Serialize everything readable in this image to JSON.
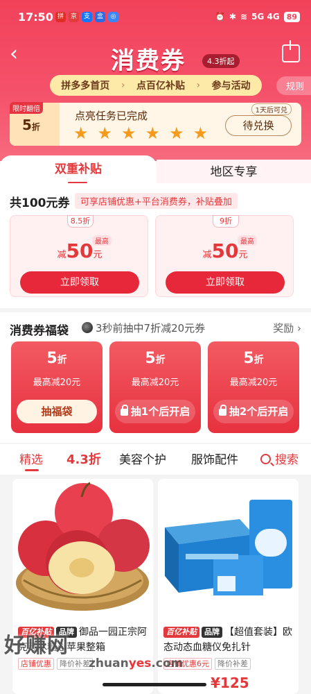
{
  "status": {
    "time": "17:50",
    "battery": "89",
    "network": "5G 4G",
    "apps": [
      "拼",
      "京",
      "支",
      "盒",
      "◎"
    ]
  },
  "header": {
    "title": "消费券",
    "discount_pill": "4.3折起",
    "rules": "规则"
  },
  "breadcrumb": {
    "items": [
      "拼多多首页",
      "点百亿补贴",
      "参与活动"
    ],
    "sep": "›"
  },
  "task": {
    "tag_top": "限时翻倍",
    "tag_value": "5",
    "tag_unit": "折",
    "message": "点亮任务已完成",
    "stars": 6,
    "badge": "1天后可兑",
    "button": "待兑换"
  },
  "tabs": {
    "active": "双重补贴",
    "other": "地区专享"
  },
  "coupons": {
    "title": "共100元券",
    "hint": "可享店铺优惠+平台消费券，补贴叠加",
    "cards": [
      {
        "discount": "8.5折",
        "max": "最高",
        "prefix": "减",
        "amount": "50",
        "unit": "元",
        "button": "立即领取"
      },
      {
        "discount": "9折",
        "max": "最高",
        "prefix": "减",
        "amount": "50",
        "unit": "元",
        "button": "立即领取"
      }
    ]
  },
  "bag": {
    "title": "消费券福袋",
    "live": "3秒前抽中7折减20元券",
    "reward": "奖励 ›",
    "cards": [
      {
        "value": "5",
        "unit": "折",
        "sub": "最高减20元",
        "button": "抽福袋",
        "locked": false
      },
      {
        "value": "5",
        "unit": "折",
        "sub": "最高减20元",
        "button": "抽1个后开启",
        "locked": true
      },
      {
        "value": "5",
        "unit": "折",
        "sub": "最高减20元",
        "button": "抽2个后开启",
        "locked": true
      }
    ]
  },
  "categories": {
    "items": [
      "精选",
      "4.3折",
      "美容个护",
      "服饰配件"
    ],
    "search": "搜索"
  },
  "products": [
    {
      "tag1": "百亿补贴",
      "tag2": "品牌",
      "title": "御品一园正宗阿克苏冰糖心苹果整箱",
      "tags": [
        "店铺优惠",
        "降价补差"
      ],
      "price": ""
    },
    {
      "tag1": "百亿补贴",
      "tag2": "品牌",
      "title": "【超值套装】欧态动态血糖仪免扎针",
      "tags": [
        "店铺优惠6元",
        "降价补差"
      ],
      "price": "¥125"
    }
  ],
  "watermark": {
    "text": "好赚网",
    "url_a": "zhuan",
    "url_b": "yes",
    "url_c": ".com"
  }
}
